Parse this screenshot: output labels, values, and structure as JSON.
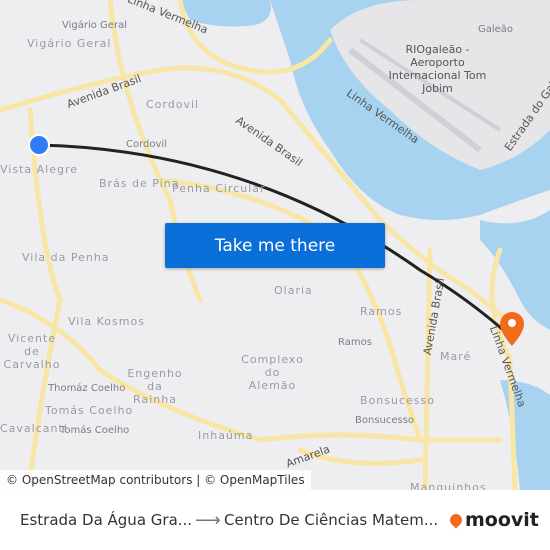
{
  "map": {
    "labels": {
      "vigario_geral_small": "Vigário Geral",
      "vigario_geral": "Vigário Geral",
      "linha_vermelha_1": "Linha Vermelha",
      "avenida_brasil_1": "Avenida Brasil",
      "cordovil_big": "Cordovil",
      "cordovil": "Cordovil",
      "vista_alegre": "Vista Alegre",
      "bras_de_pina": "Brás de Pina",
      "penha_circular": "Penha Circular",
      "avenida_brasil_2": "Avenida Brasil",
      "galeao": "Galeão",
      "airport": "RIOgaleão - Aeroporto Internacional Tom Jobim",
      "linha_vermelha_2": "Linha Vermelha",
      "estrada_do_gal": "Estrada do Gal",
      "vila_da_penha": "Vila da Penha",
      "olaria": "Olaria",
      "ramos_big": "Ramos",
      "ramos": "Ramos",
      "avenida_brasil_3": "Avenida Brasil",
      "linha_vermelha_3": "Linha Vermelha",
      "mare": "Maré",
      "vila_kosmos": "Vila Kosmos",
      "vicente_de_carvalho": "Vicente de Carvalho",
      "complexo_do_alemao": "Complexo do Alemão",
      "engenho_da_rainha": "Engenho da Rainha",
      "thomaz_coelho": "Thomáz Coelho",
      "tomas_coelho_big": "Tomás Coelho",
      "tomas_coelho": "Tomás Coelho",
      "cavalcanti": "Cavalcanti",
      "inhauma": "Inhaúma",
      "bonsucesso_big": "Bonsucesso",
      "bonsucesso": "Bonsucesso",
      "amarela": "Amarela",
      "manguinhos": "Manguinhos"
    },
    "origin_color": "#2f7cf6",
    "destination_color": "#f26a1b",
    "route_color": "#222222",
    "attribution": "© OpenStreetMap contributors | © OpenMapTiles"
  },
  "cta": {
    "label": "Take me there"
  },
  "footer": {
    "from": "Estrada Da Água Gra...",
    "arrow_icon": "arrow-right-icon",
    "to": "Centro De Ciências Matem...",
    "brand": "moovit",
    "brand_color": "#f26a1b"
  }
}
